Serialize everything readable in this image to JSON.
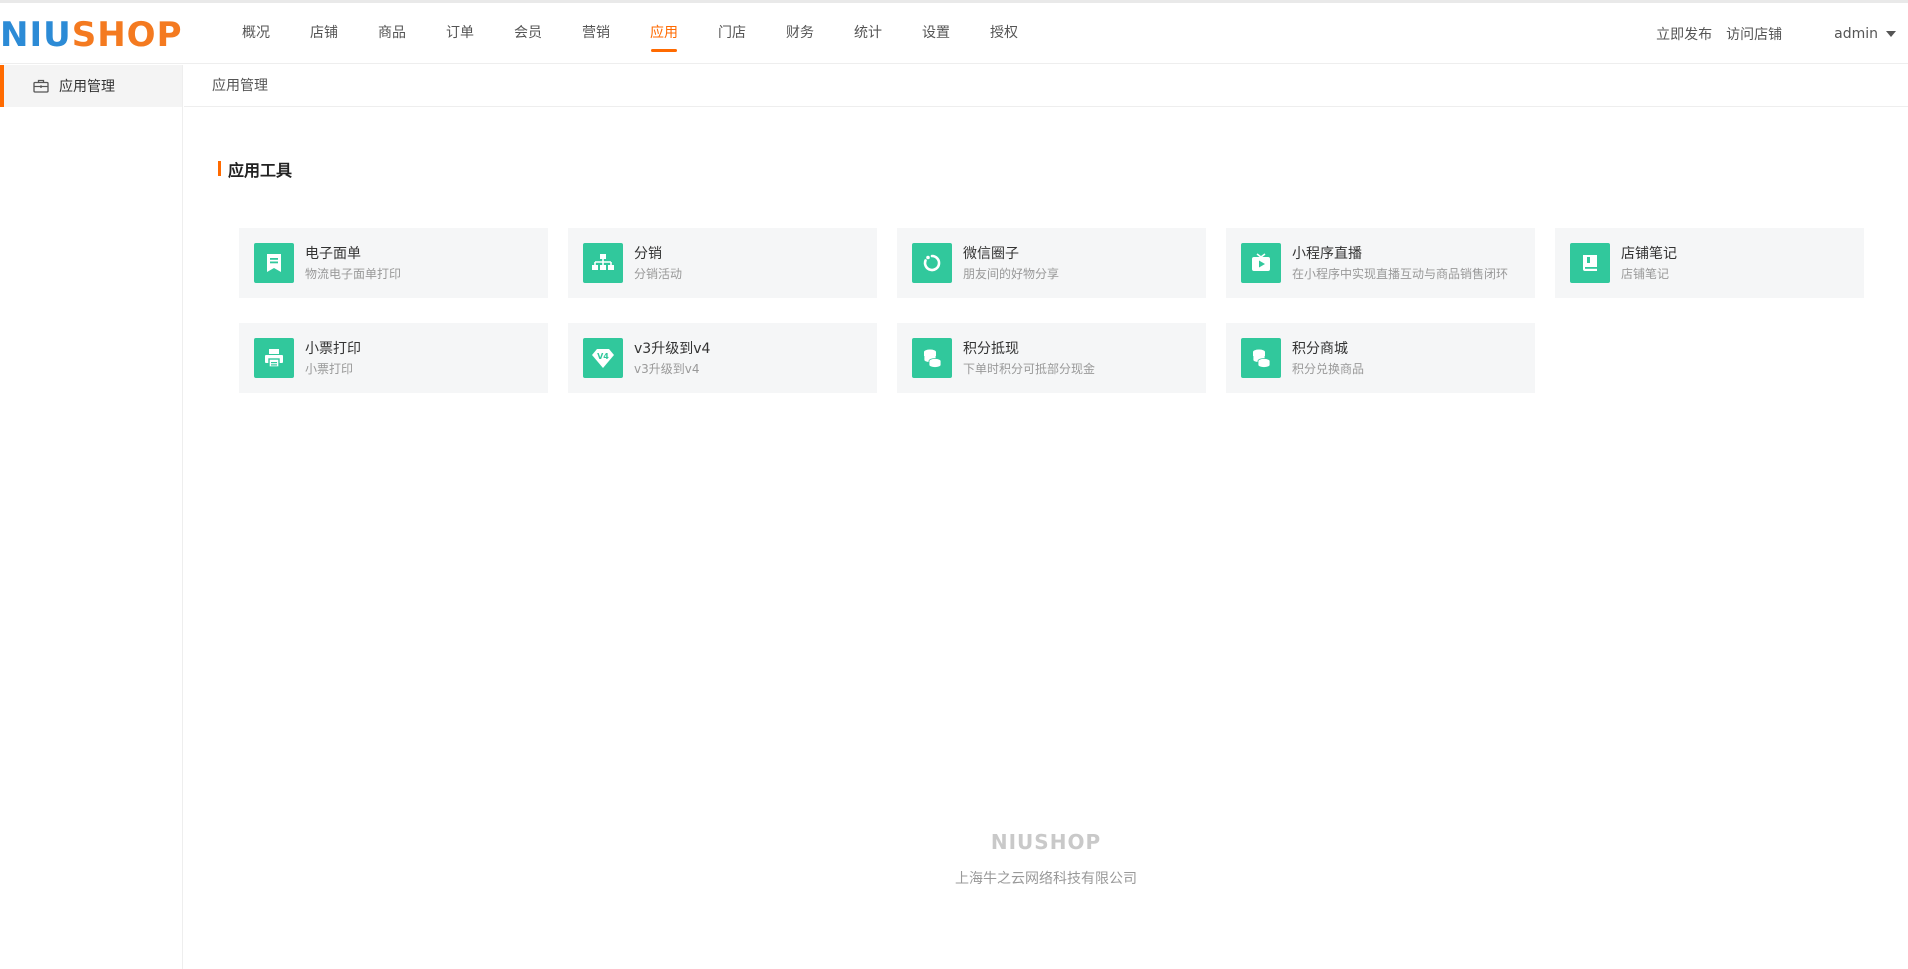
{
  "brand": {
    "logo_a": "NIU",
    "logo_b": "SHOP",
    "accent": "#ff6a00",
    "icon_bg": "#31c89c"
  },
  "nav": {
    "items": [
      "概况",
      "店铺",
      "商品",
      "订单",
      "会员",
      "营销",
      "应用",
      "门店",
      "财务",
      "统计",
      "设置",
      "授权"
    ],
    "active": "应用"
  },
  "header_right": {
    "publish": "立即发布",
    "visit": "访问店铺",
    "user": "admin"
  },
  "sidebar": {
    "items": [
      {
        "label": "应用管理",
        "icon": "briefcase-icon"
      }
    ]
  },
  "breadcrumb": "应用管理",
  "section": {
    "title": "应用工具"
  },
  "apps": [
    {
      "title": "电子面单",
      "desc": "物流电子面单打印",
      "icon": "bookmark-icon"
    },
    {
      "title": "分销",
      "desc": "分销活动",
      "icon": "org-chart-icon"
    },
    {
      "title": "微信圈子",
      "desc": "朋友间的好物分享",
      "icon": "circle-refresh-icon"
    },
    {
      "title": "小程序直播",
      "desc": "在小程序中实现直播互动与商品销售闭环",
      "icon": "tv-play-icon"
    },
    {
      "title": "店铺笔记",
      "desc": "店铺笔记",
      "icon": "book-icon"
    },
    {
      "title": "小票打印",
      "desc": "小票打印",
      "icon": "printer-icon"
    },
    {
      "title": "v3升级到v4",
      "desc": "v3升级到v4",
      "icon": "v4-diamond-icon"
    },
    {
      "title": "积分抵现",
      "desc": "下单时积分可抵部分现金",
      "icon": "coins-icon"
    },
    {
      "title": "积分商城",
      "desc": "积分兑换商品",
      "icon": "coins-icon"
    }
  ],
  "footer": {
    "logo": "NIUSHOP",
    "copyright": "上海牛之云网络科技有限公司"
  }
}
